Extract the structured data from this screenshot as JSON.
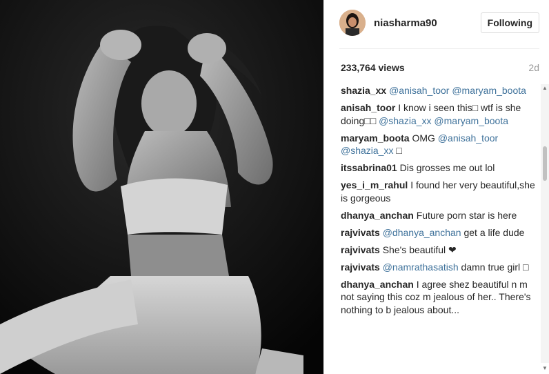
{
  "post": {
    "username": "niasharma90",
    "follow_label": "Following",
    "views": "233,764 views",
    "time_ago": "2d"
  },
  "comments": [
    {
      "user": "shazia_xx",
      "parts": [
        {
          "t": "@anisah_toor",
          "m": true
        },
        {
          "t": " ",
          "m": false
        },
        {
          "t": "@maryam_boota",
          "m": true
        }
      ]
    },
    {
      "user": "anisah_toor",
      "parts": [
        {
          "t": "I know i seen this□ wtf is she doing□□ ",
          "m": false
        },
        {
          "t": "@shazia_xx",
          "m": true
        },
        {
          "t": " ",
          "m": false
        },
        {
          "t": "@maryam_boota",
          "m": true
        }
      ]
    },
    {
      "user": "maryam_boota",
      "parts": [
        {
          "t": "OMG ",
          "m": false
        },
        {
          "t": "@anisah_toor",
          "m": true
        },
        {
          "t": " ",
          "m": false
        },
        {
          "t": "@shazia_xx",
          "m": true
        },
        {
          "t": " □",
          "m": false
        }
      ]
    },
    {
      "user": "itssabrina01",
      "parts": [
        {
          "t": "Dis grosses me out lol",
          "m": false
        }
      ]
    },
    {
      "user": "yes_i_m_rahul",
      "parts": [
        {
          "t": "I found her very beautiful,she is gorgeous",
          "m": false
        }
      ]
    },
    {
      "user": "dhanya_anchan",
      "parts": [
        {
          "t": "Future porn star is here",
          "m": false
        }
      ]
    },
    {
      "user": "rajvivats",
      "parts": [
        {
          "t": "@dhanya_anchan",
          "m": true
        },
        {
          "t": " get a life dude",
          "m": false
        }
      ]
    },
    {
      "user": "rajvivats",
      "parts": [
        {
          "t": "She's beautiful ❤",
          "m": false
        }
      ]
    },
    {
      "user": "rajvivats",
      "parts": [
        {
          "t": "@namrathasatish",
          "m": true
        },
        {
          "t": " damn true girl □",
          "m": false
        }
      ]
    },
    {
      "user": "dhanya_anchan",
      "parts": [
        {
          "t": "I agree shez beautiful n m not saying this coz m jealous of her.. There's nothing to b jealous about...",
          "m": false
        }
      ]
    }
  ],
  "colors": {
    "mention": "#3f729b",
    "text": "#262626",
    "muted": "#999999"
  },
  "icons": {
    "scroll_up": "scroll-up-arrow-icon",
    "scroll_down": "scroll-down-arrow-icon"
  }
}
